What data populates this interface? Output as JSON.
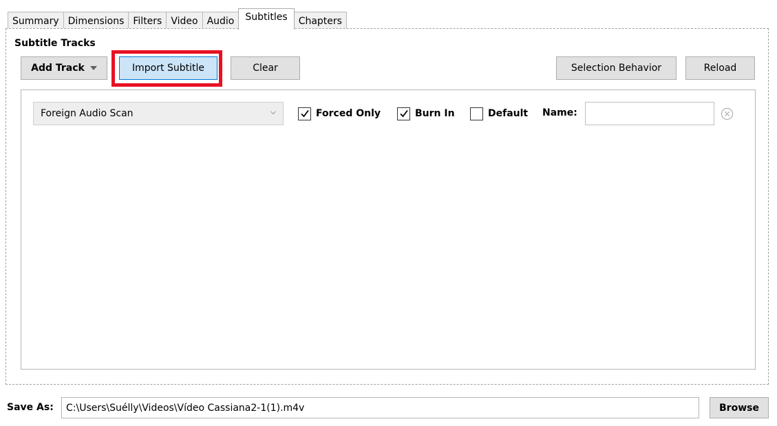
{
  "tabs": [
    {
      "label": "Summary"
    },
    {
      "label": "Dimensions"
    },
    {
      "label": "Filters"
    },
    {
      "label": "Video"
    },
    {
      "label": "Audio"
    },
    {
      "label": "Subtitles",
      "active": true
    },
    {
      "label": "Chapters"
    }
  ],
  "subtitles": {
    "section_title": "Subtitle Tracks",
    "add_track_label": "Add Track",
    "import_label": "Import Subtitle",
    "clear_label": "Clear",
    "selection_behavior_label": "Selection Behavior",
    "reload_label": "Reload",
    "track": {
      "source": "Foreign Audio Scan",
      "forced_only_label": "Forced Only",
      "forced_only": true,
      "burn_in_label": "Burn In",
      "burn_in": true,
      "default_label": "Default",
      "default": false,
      "name_label": "Name:",
      "name_value": ""
    }
  },
  "footer": {
    "save_as_label": "Save As:",
    "save_as_path": "C:\\Users\\Suélly\\Videos\\Vídeo Cassiana2-1(1).m4v",
    "browse_label": "Browse"
  },
  "colors": {
    "highlight": "#e81123",
    "accent_button": "#cce4f7",
    "accent_border": "#0078d7"
  }
}
